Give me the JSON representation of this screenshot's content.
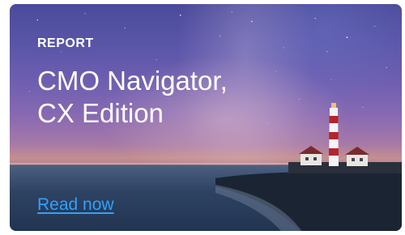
{
  "card": {
    "overline": "REPORT",
    "title_line1": "CMO Navigator,",
    "title_line2": "CX Edition",
    "cta_label": "Read now"
  },
  "colors": {
    "text": "#ffffff",
    "link": "#2ea2ff"
  }
}
